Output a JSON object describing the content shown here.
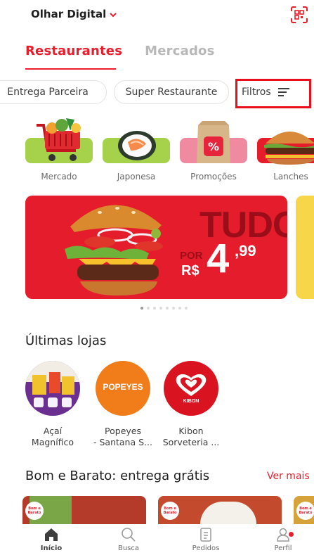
{
  "header": {
    "address": "Olhar Digital",
    "chevron_icon": "chevron-down-icon",
    "qr_icon": "qr-scan-icon"
  },
  "tabs": [
    {
      "label": "Restaurantes",
      "active": true
    },
    {
      "label": "Mercados",
      "active": false
    }
  ],
  "chips": {
    "entrega_parceira": "Entrega Parceira",
    "super_restaurante": "Super Restaurante",
    "filtros": "Filtros",
    "filtros_icon": "filter-lines-icon"
  },
  "categories": [
    {
      "label": "Mercado",
      "icon": "shopping-cart-icon"
    },
    {
      "label": "Japonesa",
      "icon": "sushi-icon"
    },
    {
      "label": "Promoções",
      "icon": "promo-bag-icon"
    },
    {
      "label": "Lanches",
      "icon": "burger-icon"
    }
  ],
  "banner": {
    "headline": "TUDO",
    "por": "POR",
    "currency": "R$",
    "price_int": "4",
    "price_cents": ",99"
  },
  "carousel": {
    "total": 8,
    "active": 1
  },
  "recent_stores": {
    "title": "Últimas lojas",
    "items": [
      {
        "line1": "Açaí",
        "line2": "Magnífico"
      },
      {
        "line1": "Popeyes",
        "line2": "- Santana S..."
      },
      {
        "line1": "Kibon",
        "line2": "Sorveteria ..."
      }
    ],
    "popeyes_logo": "POPEYES",
    "kibon_logo": "KIBON"
  },
  "promo_section": {
    "title": "Bom e Barato: entrega grátis",
    "see_more": "Ver mais",
    "card_badge": "Bom e Barato"
  },
  "bottom_nav": [
    {
      "label": "Início",
      "icon": "home-icon",
      "active": true
    },
    {
      "label": "Busca",
      "icon": "search-icon",
      "active": false
    },
    {
      "label": "Pedidos",
      "icon": "orders-icon",
      "active": false
    },
    {
      "label": "Perfil",
      "icon": "profile-icon",
      "active": false
    }
  ],
  "colors": {
    "brand": "#ea1d2c",
    "highlight_box": "#e8101d",
    "text": "#3e3e3e",
    "muted": "#b8b8b8"
  }
}
